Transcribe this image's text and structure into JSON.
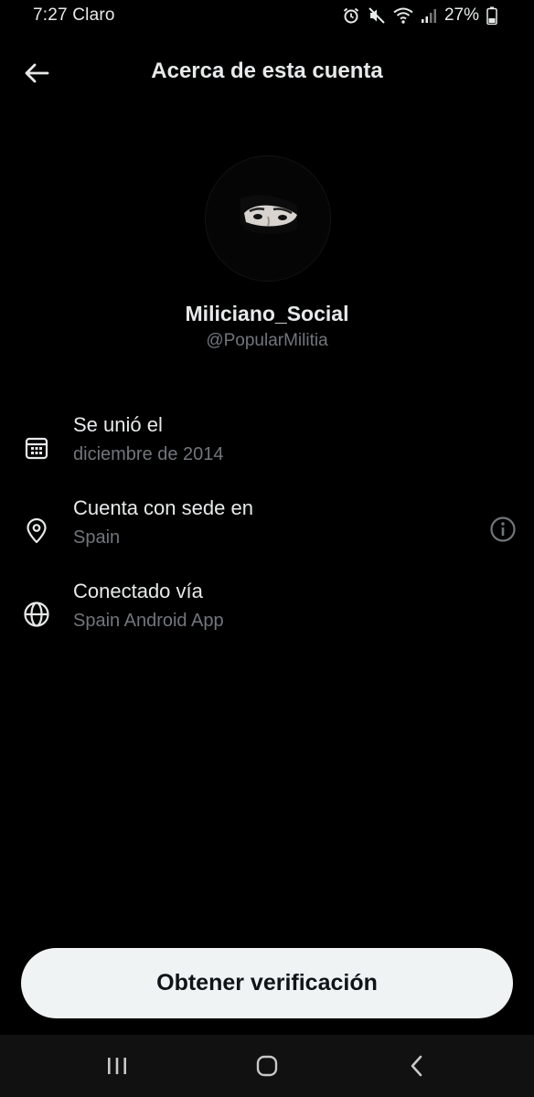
{
  "status_bar": {
    "time_carrier": "7:27 Claro",
    "battery": "27%",
    "icons": [
      "alarm-icon",
      "mute-icon",
      "wifi-icon",
      "signal-icon",
      "battery-icon"
    ]
  },
  "header": {
    "back_icon": "arrow-left-icon",
    "title": "Acerca de esta cuenta"
  },
  "profile": {
    "display_name": "Miliciano_Social",
    "handle": "@PopularMilitia"
  },
  "details": [
    {
      "icon": "calendar-icon",
      "label": "Se unió el",
      "value": "diciembre de 2014"
    },
    {
      "icon": "location-pin-icon",
      "label": "Cuenta con sede en",
      "value": "Spain",
      "info_icon": "info-icon"
    },
    {
      "icon": "globe-icon",
      "label": "Conectado vía",
      "value": "Spain Android App"
    }
  ],
  "cta": {
    "label": "Obtener verificación"
  },
  "navigation": {
    "buttons": [
      "recent-apps-icon",
      "home-icon",
      "back-icon"
    ]
  },
  "colors": {
    "background": "#000000",
    "primary_text": "#e7e9ea",
    "secondary_text": "#71767b",
    "button_bg": "#eff3f4",
    "button_text": "#0f1419",
    "navbar_bg": "#111111"
  }
}
